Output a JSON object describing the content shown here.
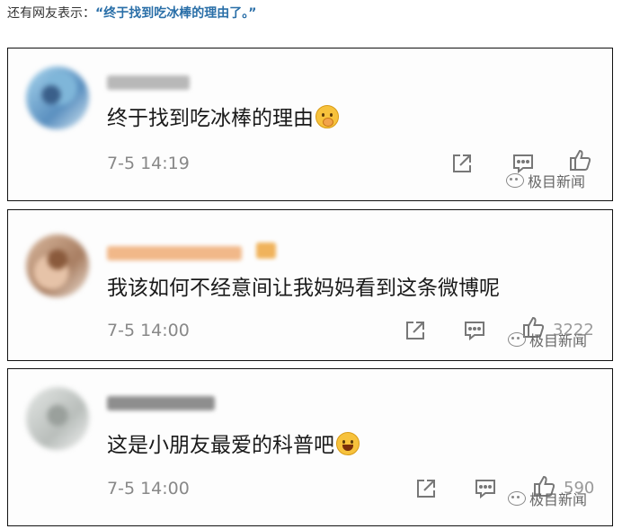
{
  "intro": {
    "lead": "还有网友表示：",
    "quote": "“终于找到吃冰棒的理由了。”"
  },
  "comments": [
    {
      "text": "终于找到吃冰棒的理由",
      "emoji": "shy-face-icon",
      "time": "7-5 14:19",
      "likes": ""
    },
    {
      "text": "我该如何不经意间让我妈妈看到这条微博呢",
      "emoji": "",
      "time": "7-5 14:00",
      "likes": "3222"
    },
    {
      "text": "这是小朋友最爱的科普吧",
      "emoji": "laughing-face-icon",
      "time": "7-5 14:00",
      "likes": "590"
    }
  ],
  "watermark": "极目新闻",
  "icons": [
    "share-icon",
    "comment-icon",
    "like-icon"
  ],
  "colors": {
    "quote": "#2a6fa8",
    "text": "#1a1a1a",
    "meta": "#888888",
    "border": "#111111"
  }
}
